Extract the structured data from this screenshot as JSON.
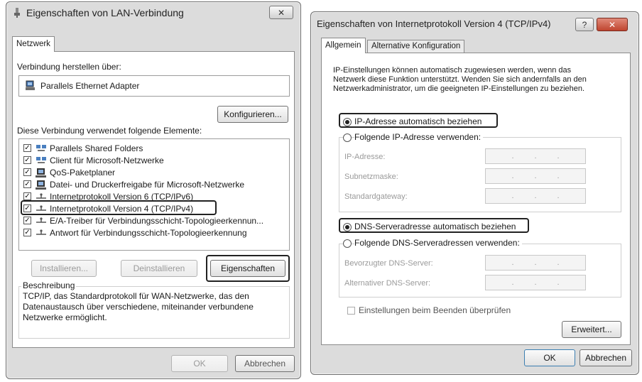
{
  "left": {
    "title": "Eigenschaften von LAN-Verbindung",
    "close_glyph": "✕",
    "tab": "Netzwerk",
    "connect_label": "Verbindung herstellen über:",
    "adapter": "Parallels Ethernet Adapter",
    "configure_button": "Konfigurieren...",
    "elements_label": "Diese Verbindung verwendet folgende Elemente:",
    "items": [
      {
        "label": "Parallels Shared Folders",
        "icon": "network-client-icon",
        "checked": true
      },
      {
        "label": "Client für Microsoft-Netzwerke",
        "icon": "network-client-icon",
        "checked": true
      },
      {
        "label": "QoS-Paketplaner",
        "icon": "computer-service-icon",
        "checked": true
      },
      {
        "label": "Datei- und Druckerfreigabe für Microsoft-Netzwerke",
        "icon": "computer-service-icon",
        "checked": true
      },
      {
        "label": "Internetprotokoll Version 6 (TCP/IPv6)",
        "icon": "protocol-icon",
        "checked": true
      },
      {
        "label": "Internetprotokoll Version 4 (TCP/IPv4)",
        "icon": "protocol-icon",
        "checked": true
      },
      {
        "label": "E/A-Treiber für Verbindungsschicht-Topologieerkennun...",
        "icon": "protocol-icon",
        "checked": true
      },
      {
        "label": "Antwort für Verbindungsschicht-Topologieerkennung",
        "icon": "protocol-icon",
        "checked": true
      }
    ],
    "install_button": "Installieren...",
    "uninstall_button": "Deinstallieren",
    "properties_button": "Eigenschaften",
    "description_label": "Beschreibung",
    "description_text": "TCP/IP, das Standardprotokoll für WAN-Netzwerke, das den Datenaustausch über verschiedene, miteinander verbundene Netzwerke ermöglicht.",
    "ok_button": "OK",
    "cancel_button": "Abbrechen"
  },
  "right": {
    "title": "Eigenschaften von Internetprotokoll Version 4 (TCP/IPv4)",
    "help_glyph": "?",
    "close_glyph": "✕",
    "tab_general": "Allgemein",
    "tab_alternative": "Alternative Konfiguration",
    "info_text": "IP-Einstellungen können automatisch zugewiesen werden, wenn das Netzwerk diese Funktion unterstützt. Wenden Sie sich andernfalls an den Netzwerkadministrator, um die geeigneten IP-Einstellungen zu beziehen.",
    "ip_auto": "IP-Adresse automatisch beziehen",
    "ip_manual": "Folgende IP-Adresse verwenden:",
    "ip_address_label": "IP-Adresse:",
    "subnet_label": "Subnetzmaske:",
    "gateway_label": "Standardgateway:",
    "dns_auto": "DNS-Serveradresse automatisch beziehen",
    "dns_manual": "Folgende DNS-Serveradressen verwenden:",
    "dns_preferred_label": "Bevorzugter DNS-Server:",
    "dns_alternative_label": "Alternativer DNS-Server:",
    "validate_label": "Einstellungen beim Beenden überprüfen",
    "advanced_button": "Erweitert...",
    "ok_button": "OK",
    "cancel_button": "Abbrechen",
    "ip_dot": "."
  }
}
